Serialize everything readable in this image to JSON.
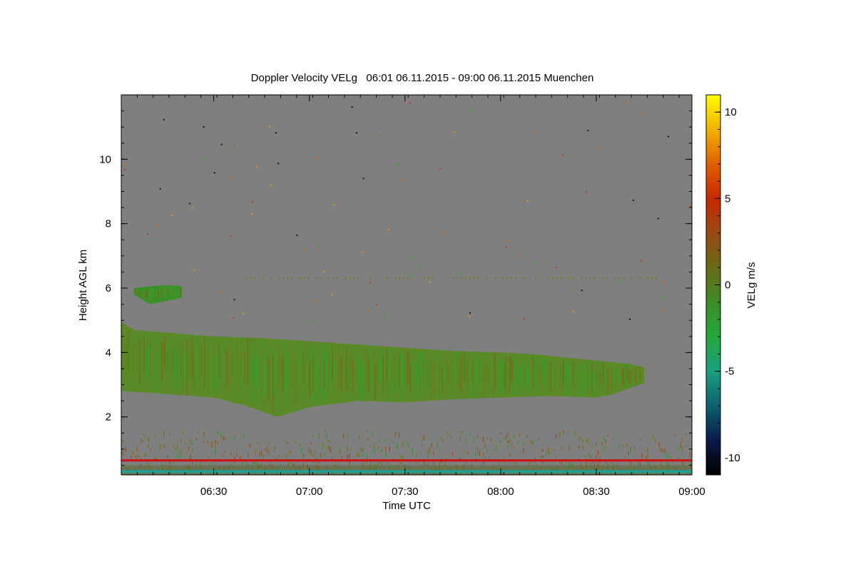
{
  "chart_data": {
    "type": "heatmap",
    "title": "Doppler Velocity VELg   06:01 06.11.2015 - 09:00 06.11.2015 Muenchen",
    "xlabel": "Time UTC",
    "ylabel": "Height AGL km",
    "xlim": [
      "06:01",
      "09:00"
    ],
    "ylim_km": [
      0.2,
      12.0
    ],
    "x_ticks": [
      "06:30",
      "07:00",
      "07:30",
      "08:00",
      "08:30",
      "09:00"
    ],
    "y_ticks": [
      2,
      4,
      6,
      8,
      10
    ],
    "background_color": "#7f7f7f",
    "colorbar": {
      "label": "VELg m/s",
      "range": [
        -11,
        11
      ],
      "ticks": [
        -10,
        -5,
        0,
        5,
        10
      ],
      "colors": [
        "#000000",
        "#0a1a4a",
        "#0d6070",
        "#1aa080",
        "#22a83a",
        "#3c8c28",
        "#6a6a14",
        "#9a4a10",
        "#c82800",
        "#e06000",
        "#f4b000",
        "#ffff00"
      ]
    },
    "cloud_layers": [
      {
        "name": "mid-level layer",
        "velocity_ms": -1.5,
        "color": "#5a8a28",
        "top_km": [
          [
            "06:01",
            4.95
          ],
          [
            "06:05",
            4.7
          ],
          [
            "06:30",
            4.5
          ],
          [
            "06:45",
            4.45
          ],
          [
            "07:00",
            4.35
          ],
          [
            "07:15",
            4.25
          ],
          [
            "07:30",
            4.15
          ],
          [
            "07:45",
            4.05
          ],
          [
            "08:00",
            4.0
          ],
          [
            "08:10",
            3.95
          ],
          [
            "08:20",
            3.85
          ],
          [
            "08:30",
            3.75
          ],
          [
            "08:40",
            3.65
          ],
          [
            "08:45",
            3.55
          ]
        ],
        "bottom_km": [
          [
            "06:01",
            2.8
          ],
          [
            "06:10",
            2.75
          ],
          [
            "06:30",
            2.6
          ],
          [
            "06:40",
            2.35
          ],
          [
            "06:50",
            2.0
          ],
          [
            "07:00",
            2.3
          ],
          [
            "07:15",
            2.5
          ],
          [
            "07:30",
            2.45
          ],
          [
            "07:45",
            2.55
          ],
          [
            "08:00",
            2.6
          ],
          [
            "08:15",
            2.65
          ],
          [
            "08:30",
            2.6
          ],
          [
            "08:35",
            2.7
          ],
          [
            "08:45",
            3.05
          ]
        ]
      },
      {
        "name": "upper patch",
        "velocity_ms": -1.5,
        "color": "#3a9028",
        "top_km": [
          [
            "06:05",
            6.0
          ],
          [
            "06:15",
            6.1
          ],
          [
            "06:20",
            6.05
          ]
        ],
        "bottom_km": [
          [
            "06:05",
            5.8
          ],
          [
            "06:10",
            5.5
          ],
          [
            "06:20",
            5.7
          ]
        ]
      }
    ],
    "near_ground": {
      "clutter_top_km": 1.6,
      "red_line_km": 0.65,
      "teal_line_km": 0.3
    }
  }
}
